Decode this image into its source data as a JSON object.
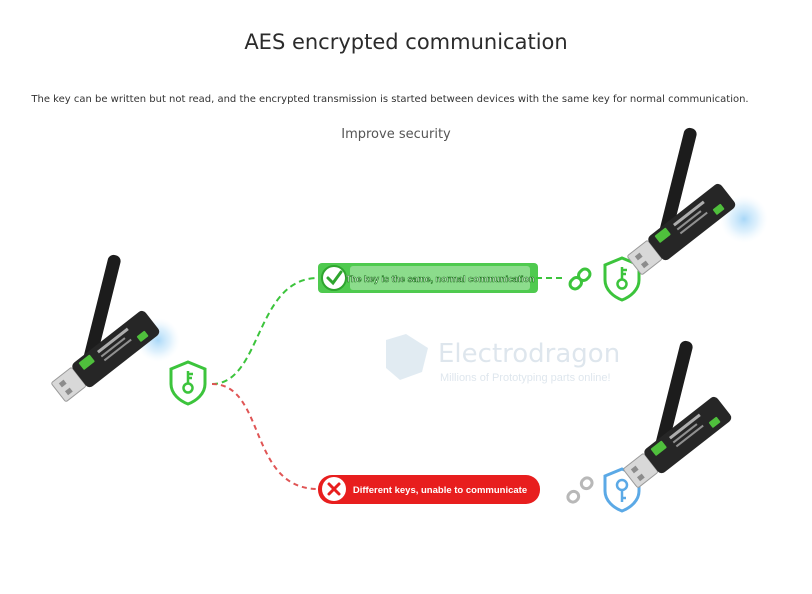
{
  "header": {
    "title": "AES encrypted communication",
    "description": "The key can be written but not read, and the encrypted transmission is started between devices with the same key for normal communication.",
    "subtitle": "Improve security"
  },
  "paths": {
    "same_key": {
      "label": "The key is the same, normal communication",
      "color": "#3cc43c",
      "status_icon": "check-icon"
    },
    "different_key": {
      "label": "Different keys, unable to communicate",
      "color": "#e81e1e",
      "status_icon": "cross-icon"
    }
  },
  "watermark": {
    "name": "Electrodragon",
    "tagline": "Millions of Prototyping parts online!"
  },
  "colors": {
    "green": "#3cc43c",
    "red": "#e81e1e",
    "blue": "#5ba9e6",
    "line_green": "#3cc43c",
    "line_red": "#e05555"
  }
}
